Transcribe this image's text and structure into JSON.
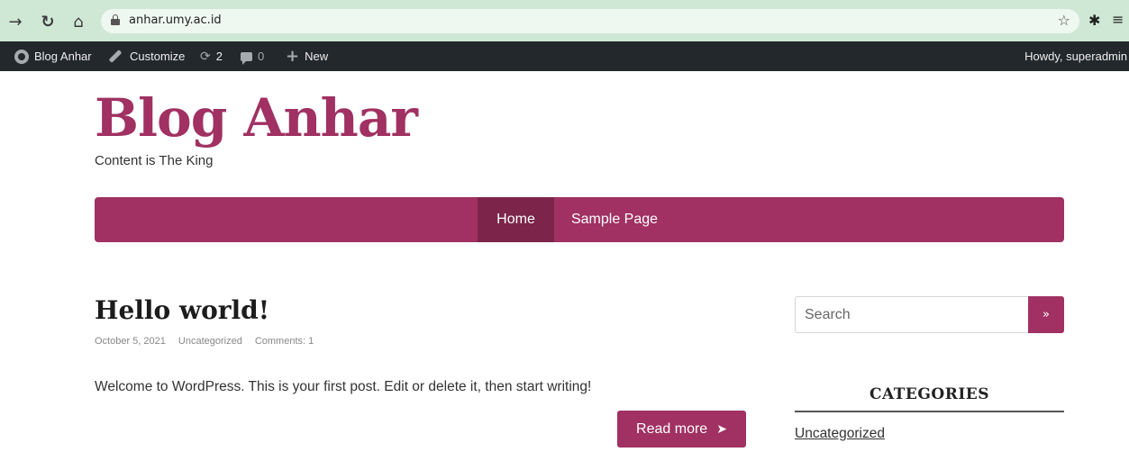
{
  "browser": {
    "url": "anhar.umy.ac.id",
    "icons": [
      "back-arrow-icon",
      "reload-icon",
      "home-icon",
      "lock-icon",
      "star-icon",
      "extensions-icon",
      "menu-icon"
    ]
  },
  "adminbar": {
    "site_name": "Blog Anhar",
    "customize": "Customize",
    "updates_count": "2",
    "comments_count": "0",
    "new_label": "New",
    "howdy": "Howdy, superadmin"
  },
  "site": {
    "title": "Blog Anhar",
    "tagline": "Content is The King",
    "accent_color": "#a03162"
  },
  "nav": {
    "items": [
      {
        "label": "Home",
        "active": true
      },
      {
        "label": "Sample Page",
        "active": false
      }
    ]
  },
  "post": {
    "title": "Hello world!",
    "date": "October 5, 2021",
    "category": "Uncategorized",
    "comments": "Comments: 1",
    "excerpt": "Welcome to WordPress. This is your first post. Edit or delete it, then start writing!",
    "read_more": "Read more"
  },
  "sidebar": {
    "search_placeholder": "Search",
    "search_button": "»",
    "categories_title": "CATEGORIES",
    "categories": [
      "Uncategorized"
    ]
  }
}
